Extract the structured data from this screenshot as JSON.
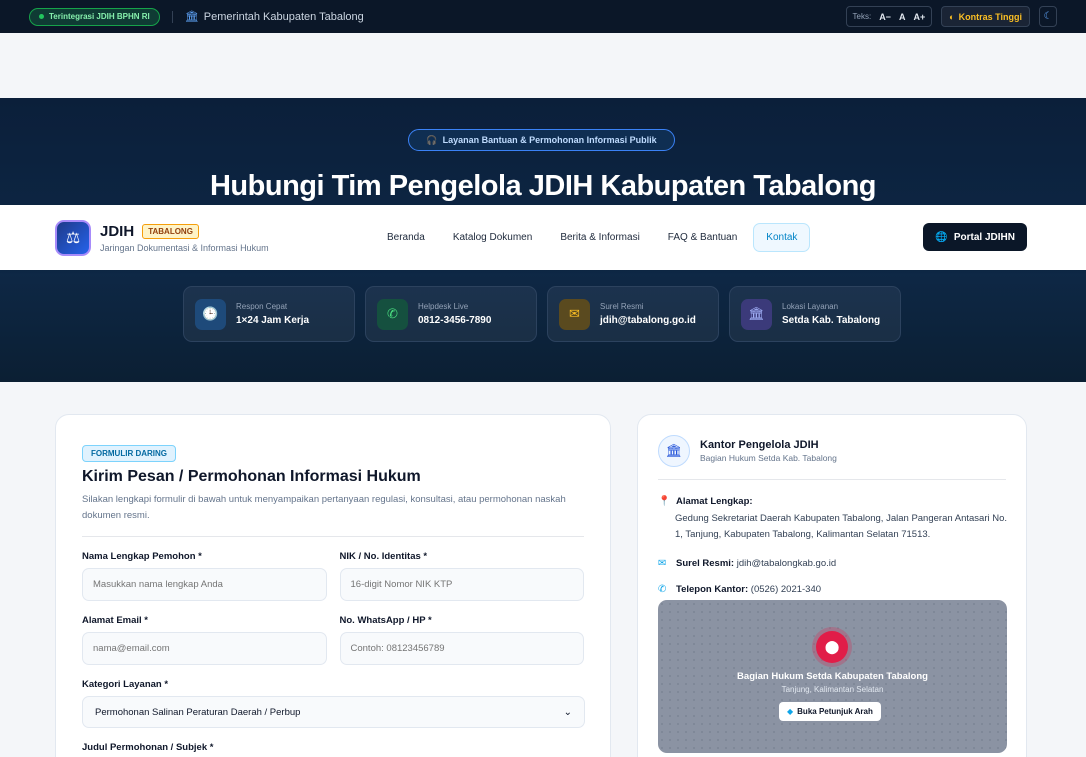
{
  "topbar": {
    "integrasi": "Terintegrasi JDIH BPHN RI",
    "pemerintah": "Pemerintah Kabupaten Tabalong",
    "teks_label": "Teks:",
    "text_smaller": "A−",
    "text_normal": "A",
    "text_larger": "A+",
    "kontras": "Kontras Tinggi"
  },
  "hero": {
    "pill": "Layanan Bantuan & Permohonan Informasi Publik",
    "title": "Hubungi Tim Pengelola JDIH Kabupaten Tabalong"
  },
  "nav": {
    "brand_name": "JDIH",
    "brand_tag": "TABALONG",
    "brand_sub": "Jaringan Dokumentasi & Informasi Hukum",
    "items": [
      {
        "label": "Beranda"
      },
      {
        "label": "Katalog Dokumen"
      },
      {
        "label": "Berita & Informasi"
      },
      {
        "label": "FAQ & Bantuan"
      },
      {
        "label": "Kontak"
      }
    ],
    "portal": "Portal JDIHN"
  },
  "cards": [
    {
      "label": "Respon Cepat",
      "value": "1×24 Jam Kerja"
    },
    {
      "label": "Helpdesk Live",
      "value": "0812-3456-7890"
    },
    {
      "label": "Surel Resmi",
      "value": "jdih@tabalong.go.id"
    },
    {
      "label": "Lokasi Layanan",
      "value": "Setda Kab. Tabalong"
    }
  ],
  "form": {
    "chip": "FORMULIR DARING",
    "title": "Kirim Pesan / Permohonan Informasi Hukum",
    "desc": "Silakan lengkapi formulir di bawah untuk menyampaikan pertanyaan regulasi, konsultasi, atau permohonan naskah dokumen resmi.",
    "nama_label": "Nama Lengkap Pemohon *",
    "nama_placeholder": "Masukkan nama lengkap Anda",
    "nik_label": "NIK / No. Identitas *",
    "nik_placeholder": "16-digit Nomor NIK KTP",
    "email_label": "Alamat Email *",
    "email_placeholder": "nama@email.com",
    "wa_label": "No. WhatsApp / HP *",
    "wa_placeholder": "Contoh: 08123456789",
    "kategori_label": "Kategori Layanan *",
    "kategori_value": "Permohonan Salinan Peraturan Daerah / Perbup",
    "judul_label": "Judul Permohonan / Subjek *"
  },
  "office": {
    "title": "Kantor Pengelola JDIH",
    "sub": "Bagian Hukum Setda Kab. Tabalong",
    "alamat_label": "Alamat Lengkap:",
    "alamat": "Gedung Sekretariat Daerah Kabupaten Tabalong, Jalan Pangeran Antasari No. 1, Tanjung, Kabupaten Tabalong, Kalimantan Selatan 71513.",
    "surel_label": "Surel Resmi:",
    "surel": "jdih@tabalongkab.go.id",
    "telepon_label": "Telepon Kantor:",
    "telepon": "(0526) 2021-340",
    "map_title": "Bagian Hukum Setda Kabupaten Tabalong",
    "map_sub": "Tanjung, Kalimantan Selatan",
    "map_btn": "Buka Petunjuk Arah"
  }
}
